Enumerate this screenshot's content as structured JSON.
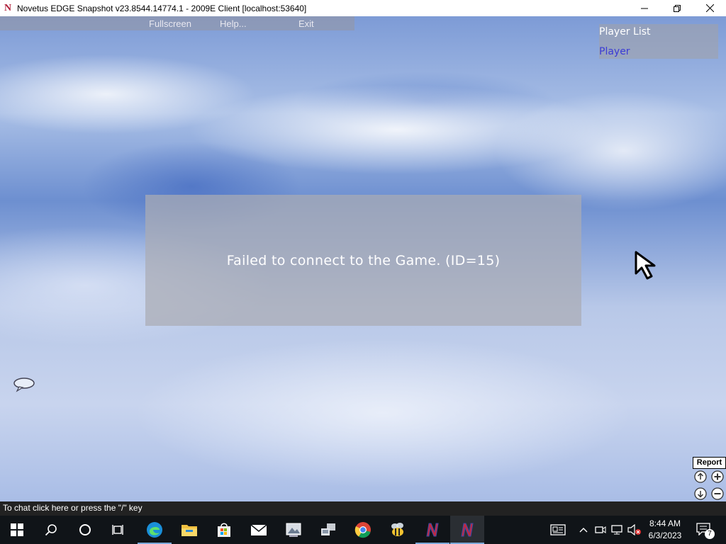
{
  "window": {
    "title": "Novetus EDGE Snapshot v23.8544.14774.1 - 2009E Client [localhost:53640]",
    "app_icon_letter": "N"
  },
  "menu": {
    "items": [
      "Fullscreen",
      "Help...",
      "Exit"
    ]
  },
  "player_list": {
    "header": "Player List",
    "players": [
      "Player"
    ]
  },
  "dialog": {
    "message": "Failed to connect to the Game. (ID=15)"
  },
  "report_label": "Report",
  "chat": {
    "hint": "To chat click here or press the \"/\" key"
  },
  "taskbar": {
    "apps": [
      "windows-start",
      "search",
      "cortana",
      "task-view",
      "edge",
      "file-explorer",
      "store",
      "mail",
      "photos",
      "network-app",
      "chrome",
      "bee-app",
      "novetus",
      "novetus-active"
    ],
    "clock_time": "8:44 AM",
    "clock_date": "6/3/2023",
    "notification_count": "7"
  },
  "colors": {
    "player_name": "#3b3bd6",
    "taskbar_bg": "#101418",
    "accent": "#7aa8d8"
  }
}
